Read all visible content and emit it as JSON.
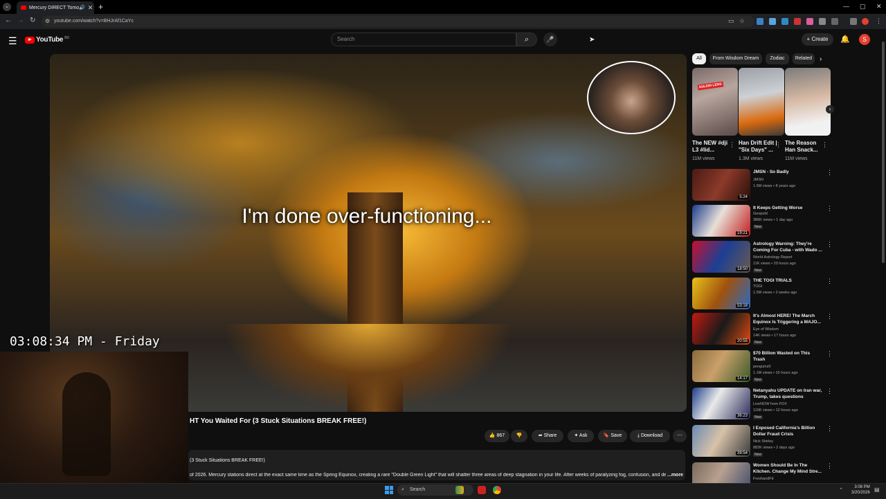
{
  "browser": {
    "tab_title": "Mercury DIRECT Tomorrow",
    "tab_close": "✕",
    "new_tab": "+",
    "url": "youtube.com/watch?v=BHJrAf1CaYc",
    "window_controls": [
      "—",
      "▢",
      "✕"
    ]
  },
  "header": {
    "logo_text": "YouTube",
    "logo_badge": "BD",
    "search_placeholder": "Search",
    "create_label": "Create",
    "avatar_letter": "S"
  },
  "video": {
    "caption": "I'm done over-functioning...",
    "title_visible": "HT You Waited For (3 Stuck Situations BREAK FREE!)"
  },
  "actions": {
    "like_count": "867",
    "share_label": "Share",
    "ask_label": "Ask",
    "save_label": "Save",
    "download_label": "Download"
  },
  "description": {
    "line1": "(3 Stuck Situations BREAK FREE!)",
    "line2": "of 2026. Mercury stations direct at the exact same time as the Spring Equinox, creating a rare \"Double Green Light\" that will shatter three areas of deep stagnation in your life. After weeks of paralyzing fog, confusion, and de",
    "more_label": "...more"
  },
  "overlay": {
    "clock": "03:08:34 PM - Friday"
  },
  "chips": [
    "All",
    "From Wisdom Dream",
    "Zodiac",
    "Related"
  ],
  "shorts": [
    {
      "title": "The NEW #dji L3 #lid...",
      "views": "11M views",
      "badge": "$16,000 LENS"
    },
    {
      "title": "Han Drift Edit | \"Six Days\" ...",
      "views": "1.3M views"
    },
    {
      "title": "The Reason Han Snack...",
      "views": "11M views"
    }
  ],
  "related": [
    {
      "title": "JMSN - So Badly",
      "channel": "JMSN",
      "meta": "1.5M views • 8 years ago",
      "duration": "5:24",
      "new": ""
    },
    {
      "title": "It Keeps Getting Worse",
      "channel": "Geopold",
      "meta": "386K views • 1 day ago",
      "duration": "19:21",
      "new": "New"
    },
    {
      "title": "Astrology Warning: They're Coming For Cuba - with Wado ...",
      "channel": "World Astrology Report",
      "meta": "11K views • 20 hours ago",
      "duration": "18:50",
      "new": "New"
    },
    {
      "title": "THE TOGI TRIALS",
      "channel": "TOGI",
      "meta": "1.5M views • 2 weeks ago",
      "duration": "53:18",
      "new": ""
    },
    {
      "title": "It's Almost HERE! The March Equinox Is Triggering a MAJO...",
      "channel": "Eye of Wisdom",
      "meta": "14K views • 17 hours ago",
      "duration": "20:55",
      "new": "New"
    },
    {
      "title": "$70 Billion Wasted on This Trash",
      "channel": "penguinz0",
      "meta": "1.1M views • 15 hours ago",
      "duration": "14:17",
      "new": "New"
    },
    {
      "title": "Netanyahu UPDATE on Iran war, Trump, takes questions",
      "channel": "LiveNOW from FOX",
      "meta": "116K views • 12 hours ago",
      "duration": "36:23",
      "new": "New"
    },
    {
      "title": "I Exposed California's Billion Dollar Fraud Crisis",
      "channel": "Nick Shirley",
      "meta": "882K views • 2 days ago",
      "duration": "39:54",
      "new": "New"
    },
    {
      "title": "Women Should Be In The Kitchen. Change My Mind Stre...",
      "channel": "FreshandFit",
      "meta": "",
      "duration": "",
      "new": ""
    }
  ],
  "taskbar": {
    "search_label": "Search",
    "time": "3:08 PM",
    "date": "3/20/2026"
  },
  "colors": {
    "brand_red": "#ff0000",
    "bg": "#0f0f0f",
    "chip_bg": "#272727"
  }
}
